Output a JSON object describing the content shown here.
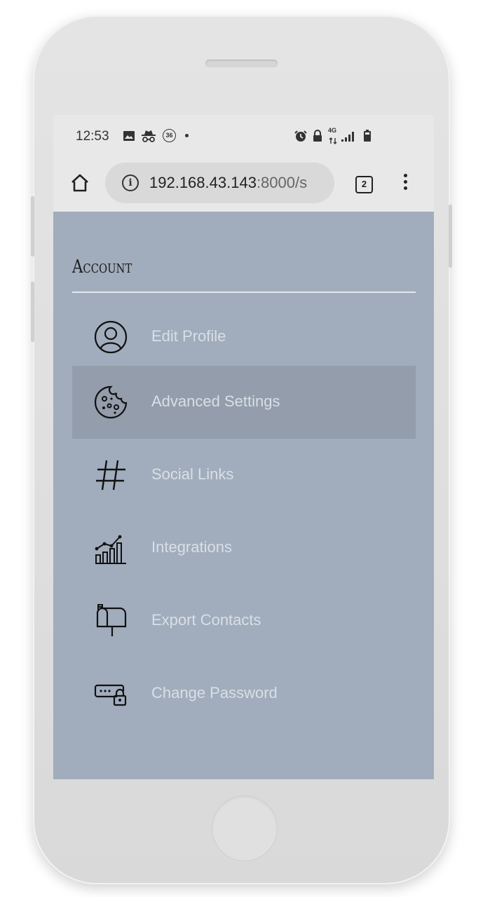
{
  "status_bar": {
    "time": "12:53",
    "notification_badge": "36",
    "network": "4G",
    "left_icons": [
      "image-icon",
      "incognito-icon",
      "badge-36-icon",
      "dot-icon"
    ],
    "right_icons": [
      "alarm-icon",
      "lock-icon",
      "4g-icon",
      "signal-icon",
      "battery-icon"
    ]
  },
  "browser": {
    "url_host": "192.168.43.143",
    "url_rest": ":8000/s",
    "tab_count": "2"
  },
  "section": {
    "title": "Account",
    "items": [
      {
        "label": "Edit Profile",
        "icon": "user-circle-icon",
        "active": false
      },
      {
        "label": "Advanced Settings",
        "icon": "cookie-icon",
        "active": true
      },
      {
        "label": "Social Links",
        "icon": "hashtag-icon",
        "active": false
      },
      {
        "label": "Integrations",
        "icon": "chart-growth-icon",
        "active": false
      },
      {
        "label": "Export Contacts",
        "icon": "mailbox-icon",
        "active": false
      },
      {
        "label": "Change Password",
        "icon": "password-lock-icon",
        "active": false
      }
    ]
  },
  "colors": {
    "content_bg": "#a1adbd",
    "active_item_bg": "#939dab",
    "item_label": "#d9dfe5",
    "chrome_bg": "#e8e8e8"
  }
}
